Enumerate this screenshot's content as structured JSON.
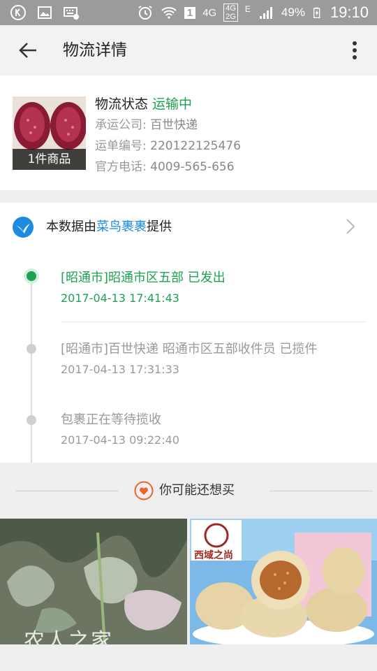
{
  "status_bar": {
    "network_a": "4G",
    "network_b": "4G",
    "network_c": "2G",
    "network_d": "E",
    "sim_slot": "1",
    "battery": "49%",
    "time": "19:10"
  },
  "header": {
    "title": "物流详情"
  },
  "package": {
    "thumb_caption": "1件商品",
    "status_label": "物流状态",
    "status_value": "运输中",
    "carrier_label": "承运公司:",
    "carrier_value": "百世快递",
    "tracking_label": "运单编号:",
    "tracking_value": "220122125476",
    "phone_label": "官方电话:",
    "phone_value": "4009-565-656"
  },
  "provider": {
    "prefix": "本数据由",
    "brand": "菜鸟裹裹",
    "suffix": "提供"
  },
  "events": [
    {
      "text": "[昭通市]昭通市区五部 已发出",
      "time": "2017-04-13 17:41:43"
    },
    {
      "text": "[昭通市]百世快递 昭通市区五部收件员 已揽件",
      "time": "2017-04-13 17:31:33"
    },
    {
      "text": "包裹正在等待揽收",
      "time": "2017-04-13 09:22:40"
    }
  ],
  "recommend": {
    "title": "你可能还想买"
  },
  "products": [
    {
      "watermark": "农人之家"
    },
    {
      "brand_text": "西域之尚"
    }
  ],
  "colors": {
    "accent_green": "#1ea153",
    "cainiao_blue": "#1d8be0",
    "heart_orange": "#f0622d",
    "statusbar_gray": "#9b9b9b"
  }
}
